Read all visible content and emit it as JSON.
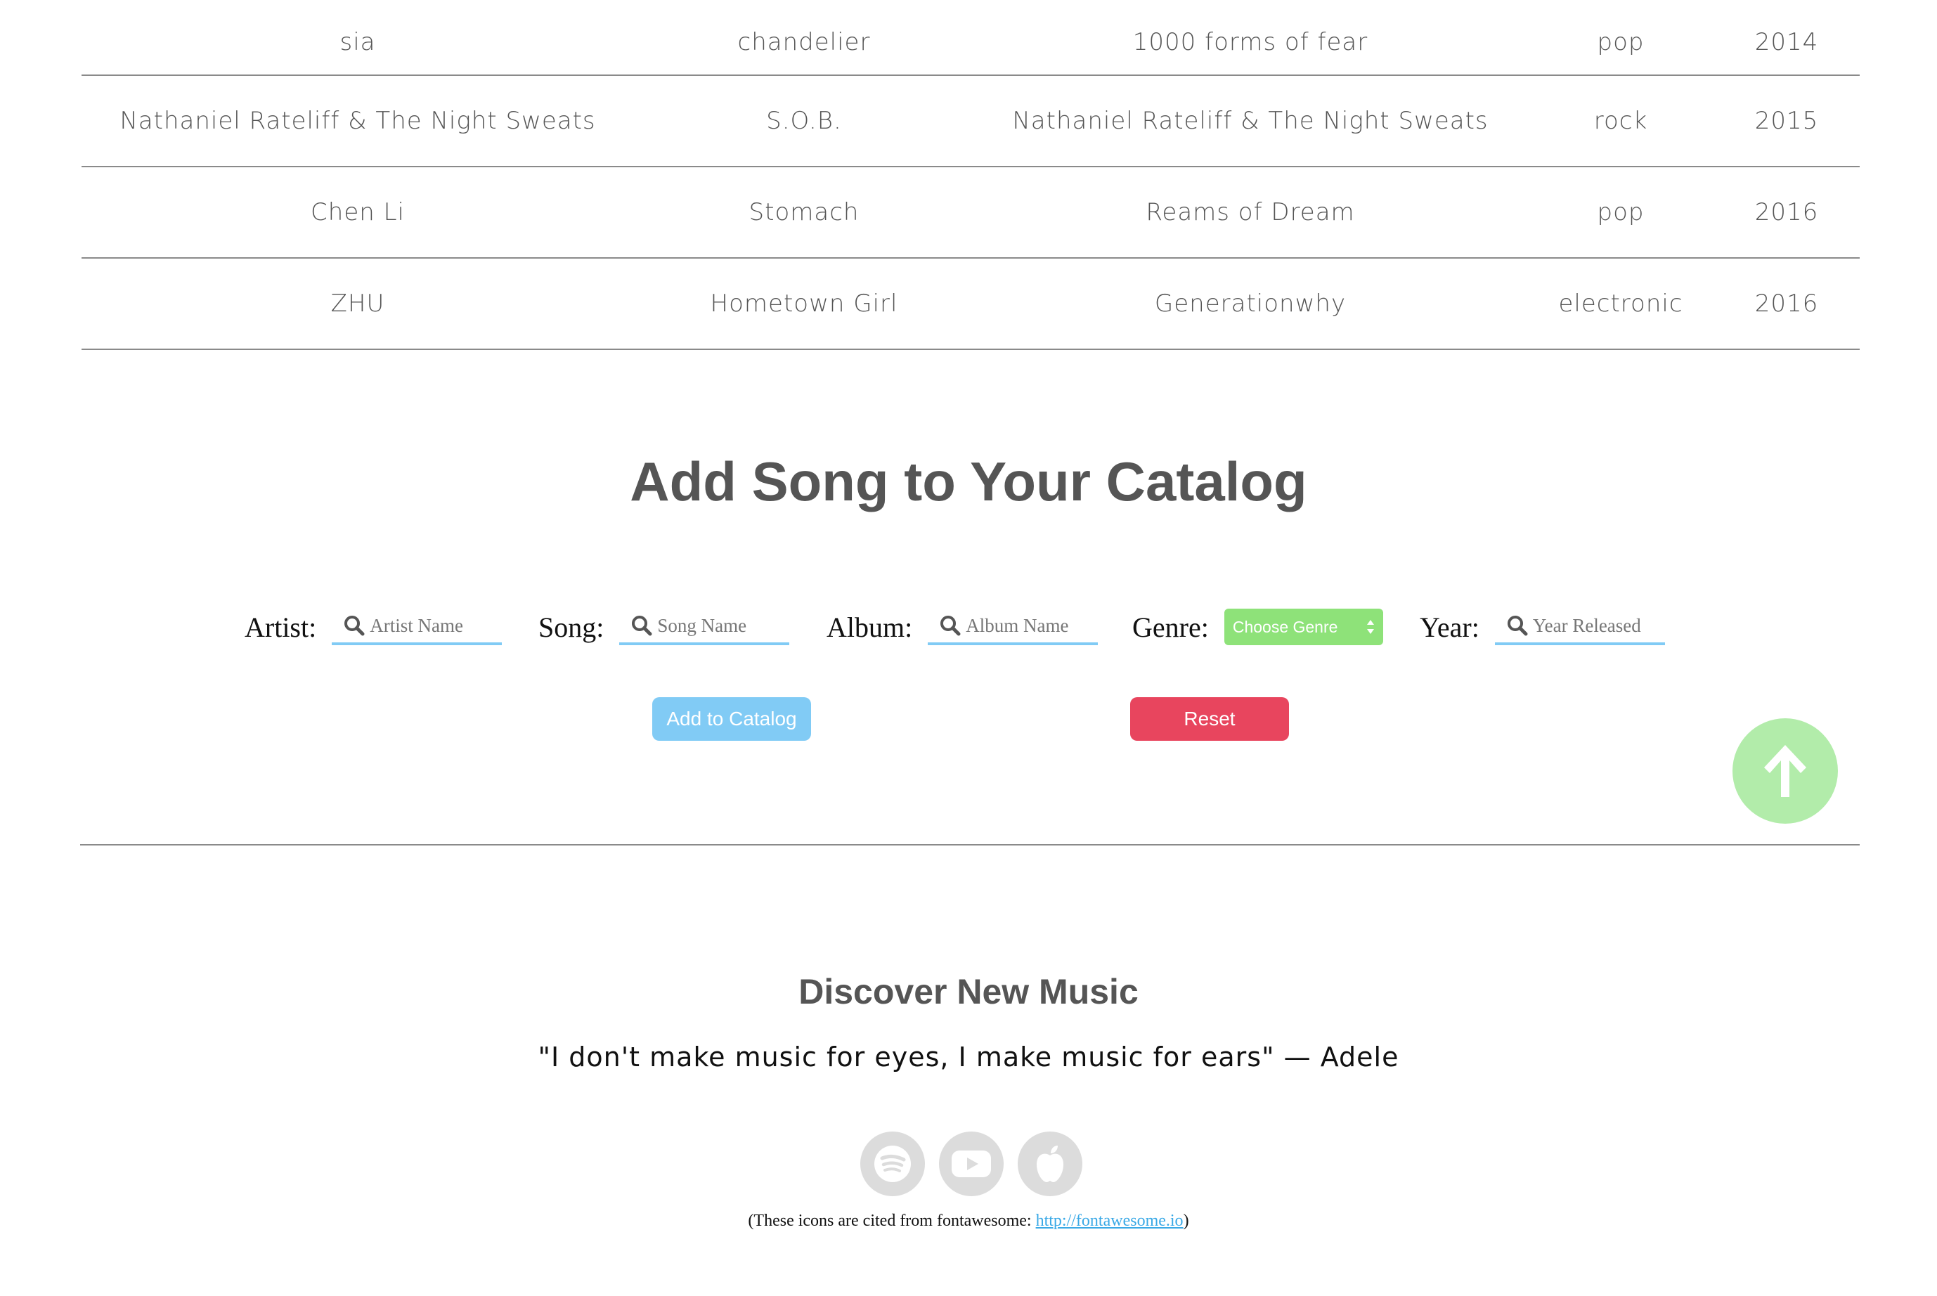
{
  "songs": [
    {
      "artist": "sia",
      "song": "chandelier",
      "album": "1000 forms of fear",
      "genre": "pop",
      "year": "2014"
    },
    {
      "artist": "Nathaniel Rateliff & The Night Sweats",
      "song": "S.O.B.",
      "album": "Nathaniel Rateliff & The Night Sweats",
      "genre": "rock",
      "year": "2015"
    },
    {
      "artist": "Chen Li",
      "song": "Stomach",
      "album": "Reams of Dream",
      "genre": "pop",
      "year": "2016"
    },
    {
      "artist": "ZHU",
      "song": "Hometown Girl",
      "album": "Generationwhy",
      "genre": "electronic",
      "year": "2016"
    }
  ],
  "add_form": {
    "title": "Add Song to Your Catalog",
    "artist": {
      "label": "Artist:",
      "placeholder": "Artist Name",
      "value": ""
    },
    "song": {
      "label": "Song:",
      "placeholder": "Song Name",
      "value": ""
    },
    "album": {
      "label": "Album:",
      "placeholder": "Album Name",
      "value": ""
    },
    "genre": {
      "label": "Genre:",
      "selected": "Choose Genre"
    },
    "year": {
      "label": "Year:",
      "placeholder": "Year Released",
      "value": ""
    },
    "add_button": "Add to Catalog",
    "reset_button": "Reset"
  },
  "footer": {
    "title": "Discover New Music",
    "quote": "\"I don't make music for eyes, I make music for ears\" — Adele",
    "icons": [
      "spotify-icon",
      "youtube-icon",
      "apple-icon"
    ],
    "credit_prefix": "(These icons are cited from fontawesome: ",
    "credit_link": "http://fontawesome.io",
    "credit_suffix": ")"
  },
  "colors": {
    "accent_blue": "#81cbf5",
    "genre_green": "#8ee279",
    "reset_red": "#e8455e",
    "scroll_top_green": "#b2ecaa",
    "icon_gray": "#dcdcdc"
  }
}
